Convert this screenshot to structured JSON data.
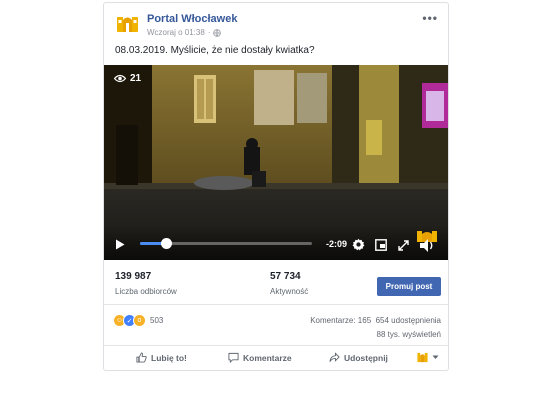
{
  "post": {
    "page_name": "Portal Włocławek",
    "timestamp": "Wczoraj o 01:38",
    "text": "08.03.2019. Myślicie, że nie dostały kwiatka?"
  },
  "video": {
    "views": "21",
    "time_remaining": "-2:09",
    "progress": 0.15
  },
  "stats": {
    "reach_value": "139 987",
    "reach_label": "Liczba odbiorców",
    "engagement_value": "57 734",
    "engagement_label": "Aktywność",
    "promote_label": "Promuj post"
  },
  "reactions": {
    "count": "503",
    "comments": "Komentarze: 165",
    "shares": "654 udostępnienia",
    "views": "88 tys. wyświetleń"
  },
  "actions": {
    "like": "Lubię to!",
    "comment": "Komentarze",
    "share": "Udostępnij"
  },
  "colors": {
    "brand": "#4267b2",
    "link": "#365899",
    "progress": "#4b8cf5"
  }
}
